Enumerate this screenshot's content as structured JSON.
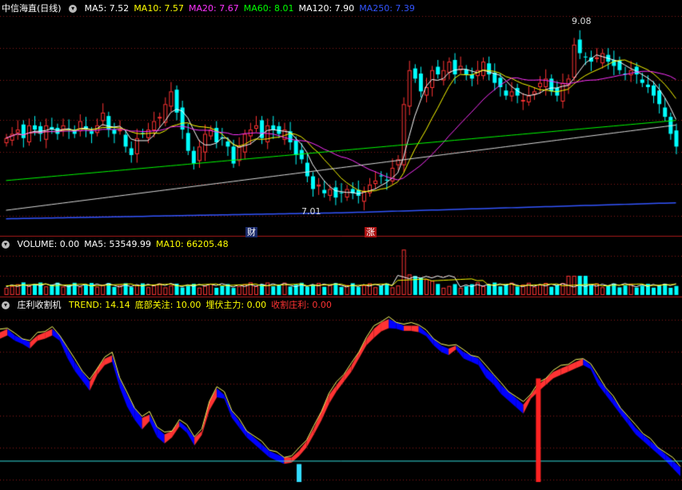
{
  "header": {
    "title": "中信海直(日线)",
    "ma_items": [
      {
        "label": "MA5: 7.52",
        "color": "#ffffff"
      },
      {
        "label": "MA10: 7.57",
        "color": "#ffff00"
      },
      {
        "label": "MA20: 7.67",
        "color": "#ff33ff"
      },
      {
        "label": "MA60: 8.01",
        "color": "#00ff00"
      },
      {
        "label": "MA120: 7.90",
        "color": "#ffffff"
      },
      {
        "label": "MA250: 7.39",
        "color": "#3355ff"
      }
    ]
  },
  "volume_header": {
    "items": [
      {
        "label": "VOLUME: 0.00",
        "color": "#ffffff"
      },
      {
        "label": "MA5: 53549.99",
        "color": "#ffffff"
      },
      {
        "label": "MA10: 66205.48",
        "color": "#ffff00"
      }
    ]
  },
  "indicator_header": {
    "title": "庄利收割机",
    "items": [
      {
        "label": "TREND: 14.14",
        "color": "#ffff00"
      },
      {
        "label": "底部关注: 10.00",
        "color": "#ffff00"
      },
      {
        "label": "埋伏主力: 0.00",
        "color": "#ffff00"
      },
      {
        "label": "收割庄利: 0.00",
        "color": "#ff3333"
      }
    ]
  },
  "annotations": {
    "high_label": "9.08",
    "low_label": "7.01",
    "tag_cai": "财",
    "tag_zhang": "涨"
  },
  "colors": {
    "up": "#ff3333",
    "down": "#00ffff",
    "band_up": "#ff3333",
    "band_down": "#0000ff",
    "grid": "#8b1a1a",
    "trend_line": "#ffff66"
  },
  "chart_data": {
    "type": "candlestick",
    "price_range": [
      6.8,
      9.2
    ],
    "closes": [
      7.8,
      7.85,
      7.9,
      7.8,
      7.95,
      7.9,
      7.85,
      7.95,
      7.9,
      7.85,
      7.95,
      7.9,
      7.85,
      8.0,
      7.9,
      7.85,
      7.95,
      8.1,
      7.9,
      7.85,
      7.9,
      7.7,
      7.6,
      7.8,
      7.85,
      7.9,
      8.0,
      8.05,
      8.2,
      8.35,
      8.1,
      7.9,
      7.65,
      7.5,
      7.7,
      7.85,
      7.9,
      7.75,
      7.8,
      7.7,
      7.5,
      7.7,
      7.85,
      7.9,
      7.95,
      7.8,
      7.95,
      7.9,
      7.85,
      7.9,
      7.75,
      7.6,
      7.55,
      7.35,
      7.2,
      7.25,
      7.15,
      7.2,
      7.1,
      7.15,
      7.2,
      7.15,
      7.12,
      7.18,
      7.25,
      7.3,
      7.35,
      7.3,
      7.45,
      7.55,
      8.2,
      8.6,
      8.5,
      8.35,
      8.4,
      8.6,
      8.55,
      8.6,
      8.7,
      8.55,
      8.65,
      8.55,
      8.5,
      8.6,
      8.7,
      8.55,
      8.45,
      8.4,
      8.3,
      8.35,
      8.3,
      8.25,
      8.3,
      8.35,
      8.45,
      8.5,
      8.35,
      8.3,
      8.45,
      8.5,
      8.9,
      8.8,
      8.75,
      8.7,
      8.75,
      8.8,
      8.7,
      8.65,
      8.6,
      8.55,
      8.6,
      8.55,
      8.45,
      8.4,
      8.3,
      8.2,
      8.05,
      7.85,
      7.7
    ],
    "volume_range": [
      0,
      230000
    ],
    "volume_spike_index": 70,
    "indicator_range": [
      0,
      100
    ],
    "trend_fast": [
      88,
      90,
      86,
      84,
      82,
      86,
      88,
      90,
      86,
      78,
      70,
      64,
      58,
      66,
      72,
      74,
      60,
      50,
      42,
      36,
      38,
      30,
      26,
      28,
      34,
      30,
      24,
      28,
      46,
      54,
      50,
      40,
      34,
      28,
      24,
      20,
      16,
      14,
      12,
      12,
      16,
      22,
      30,
      40,
      50,
      56,
      62,
      68,
      76,
      84,
      90,
      94,
      96,
      94,
      92,
      92,
      92,
      88,
      84,
      80,
      78,
      80,
      76,
      74,
      72,
      66,
      62,
      56,
      52,
      48,
      44,
      50,
      56,
      60,
      64,
      66,
      68,
      70,
      72,
      68,
      60,
      54,
      48,
      42,
      36,
      30,
      26,
      22,
      18,
      14,
      10,
      6
    ],
    "trend_slow": [
      86,
      88,
      87,
      85,
      84,
      85,
      86,
      88,
      87,
      82,
      74,
      68,
      62,
      64,
      70,
      72,
      64,
      56,
      48,
      42,
      40,
      34,
      30,
      30,
      33,
      31,
      27,
      28,
      42,
      50,
      50,
      42,
      36,
      30,
      26,
      22,
      18,
      16,
      14,
      13,
      15,
      20,
      28,
      36,
      46,
      54,
      60,
      66,
      74,
      82,
      86,
      90,
      92,
      92,
      91,
      91,
      90,
      88,
      86,
      82,
      80,
      80,
      78,
      76,
      74,
      70,
      66,
      60,
      56,
      52,
      48,
      50,
      54,
      58,
      62,
      64,
      66,
      68,
      70,
      68,
      62,
      56,
      50,
      44,
      38,
      32,
      28,
      24,
      20,
      16,
      13,
      10
    ],
    "signal_bars": [
      {
        "index": 40,
        "value": 8,
        "color": "cyan"
      },
      {
        "index": 72,
        "value": 60,
        "color": "red"
      }
    ],
    "bottom_level": 10
  }
}
